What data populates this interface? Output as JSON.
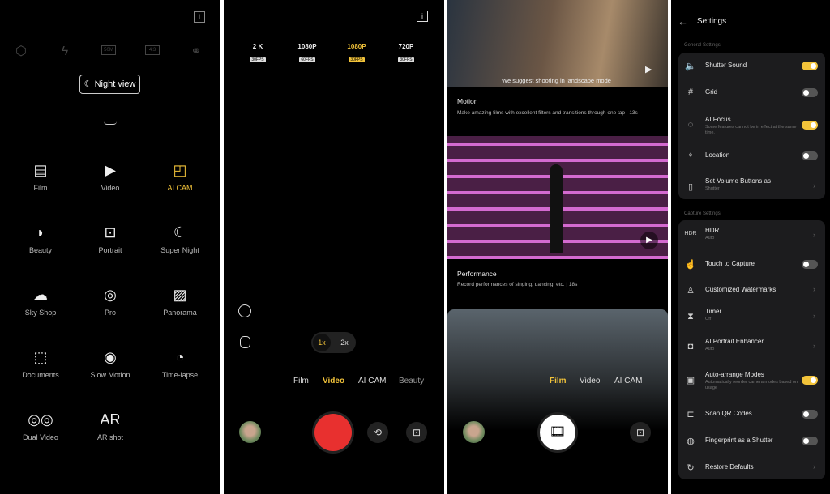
{
  "panel1": {
    "top_icons": [
      "settings-hexagon-icon",
      "flash-off-icon",
      "50M",
      "4:3",
      "filter-icon"
    ],
    "info_icon": "info-icon",
    "night_view_label": "Night view",
    "modes": [
      {
        "label": "Film",
        "icon": "film-icon"
      },
      {
        "label": "Video",
        "icon": "video-icon"
      },
      {
        "label": "AI CAM",
        "icon": "ai-cam-icon",
        "active": true
      },
      {
        "label": "Beauty",
        "icon": "beauty-icon"
      },
      {
        "label": "Portrait",
        "icon": "portrait-icon"
      },
      {
        "label": "Super Night",
        "icon": "super-night-icon"
      },
      {
        "label": "Sky Shop",
        "icon": "sky-shop-icon"
      },
      {
        "label": "Pro",
        "icon": "pro-icon"
      },
      {
        "label": "Panorama",
        "icon": "panorama-icon"
      },
      {
        "label": "Documents",
        "icon": "documents-icon"
      },
      {
        "label": "Slow Motion",
        "icon": "slow-motion-icon"
      },
      {
        "label": "Time-lapse",
        "icon": "time-lapse-icon"
      },
      {
        "label": "Dual Video",
        "icon": "dual-video-icon"
      },
      {
        "label": "AR shot",
        "icon": "ar-shot-icon"
      }
    ]
  },
  "panel2": {
    "resolutions": [
      {
        "res": "2 K",
        "fps": "30FPS"
      },
      {
        "res": "1080P",
        "fps": "60FPS"
      },
      {
        "res": "1080P",
        "fps": "30FPS",
        "selected": true
      },
      {
        "res": "720P",
        "fps": "30FPS"
      }
    ],
    "zoom": [
      "1x",
      "2x"
    ],
    "zoom_selected": "1x",
    "modes": [
      "Film",
      "Video",
      "AI CAM",
      "Beauty"
    ],
    "active_mode": "Video",
    "record_color": "#e8302f"
  },
  "panel3": {
    "banner": "We suggest shooting in landscape mode",
    "videos": [
      {
        "title": "Motion",
        "desc": "Make amazing films with excellent filters and transitions through one tap | 13s"
      },
      {
        "title": "Performance",
        "desc": "Record performances of singing, dancing, etc. | 18s"
      }
    ],
    "modes": [
      "Film",
      "Video",
      "AI CAM"
    ],
    "active_mode": "Film"
  },
  "panel4": {
    "title": "Settings",
    "general_label": "General Settings",
    "general": [
      {
        "label": "Shutter Sound",
        "icon": "speaker-icon",
        "toggle": true
      },
      {
        "label": "Grid",
        "icon": "grid-icon",
        "toggle": false
      },
      {
        "label": "AI Focus",
        "sub": "Some features cannot be in effect at the same time.",
        "icon": "ai-focus-icon",
        "toggle": true
      },
      {
        "label": "Location",
        "icon": "location-icon",
        "toggle": false
      },
      {
        "label": "Set Volume Buttons as",
        "sub": "Shutter",
        "icon": "phone-icon",
        "chevron": true
      }
    ],
    "capture_label": "Capture Settings",
    "capture": [
      {
        "label": "HDR",
        "sub": "Auto",
        "icon": "HDR",
        "chevron": true
      },
      {
        "label": "Touch to Capture",
        "icon": "touch-icon",
        "toggle": false
      },
      {
        "label": "Customized Watermarks",
        "icon": "stamp-icon",
        "chevron": true
      },
      {
        "label": "Timer",
        "sub": "Off",
        "icon": "hourglass-icon",
        "chevron": true
      },
      {
        "label": "AI Portrait Enhancer",
        "sub": "Auto",
        "icon": "portrait-enhancer-icon",
        "chevron": true
      },
      {
        "label": "Auto-arrange Modes",
        "sub": "Automatically reorder camera modes based on usage",
        "icon": "auto-arrange-icon",
        "toggle": true
      },
      {
        "label": "Scan QR Codes",
        "icon": "scan-icon",
        "toggle": false
      },
      {
        "label": "Fingerprint as a Shutter",
        "icon": "fingerprint-icon",
        "toggle": false
      },
      {
        "label": "Restore Defaults",
        "icon": "restore-icon",
        "chevron": true
      }
    ],
    "accent": "#f2c33a"
  }
}
